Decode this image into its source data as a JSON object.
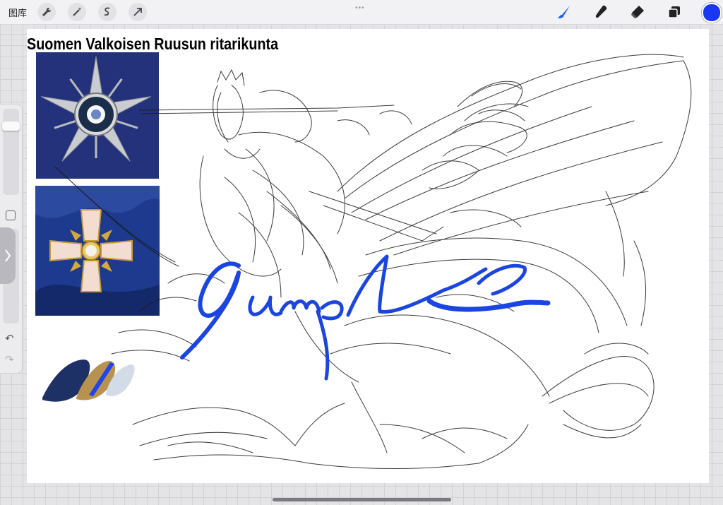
{
  "toolbar": {
    "gallery_label": "图库",
    "left_tools": [
      "wrench-icon",
      "magic-wand-icon",
      "selection-icon",
      "transform-arrow-icon"
    ],
    "right_tools": [
      "brush-icon",
      "smudge-icon",
      "eraser-icon",
      "layers-icon"
    ],
    "active_color": "#1a38f0"
  },
  "sidebar": {
    "undo_symbol": "↶",
    "redo_symbol": "↷"
  },
  "canvas": {
    "reference_title": "Suomen Valkoisen Ruusun ritarikunta",
    "reference_images": [
      "star-medal-image",
      "cross-medal-image"
    ],
    "palette_colors": [
      "#1e3166",
      "#b8924f",
      "#2045e8",
      "#d4dbe8"
    ],
    "watermark_color": "#1a45e0"
  }
}
